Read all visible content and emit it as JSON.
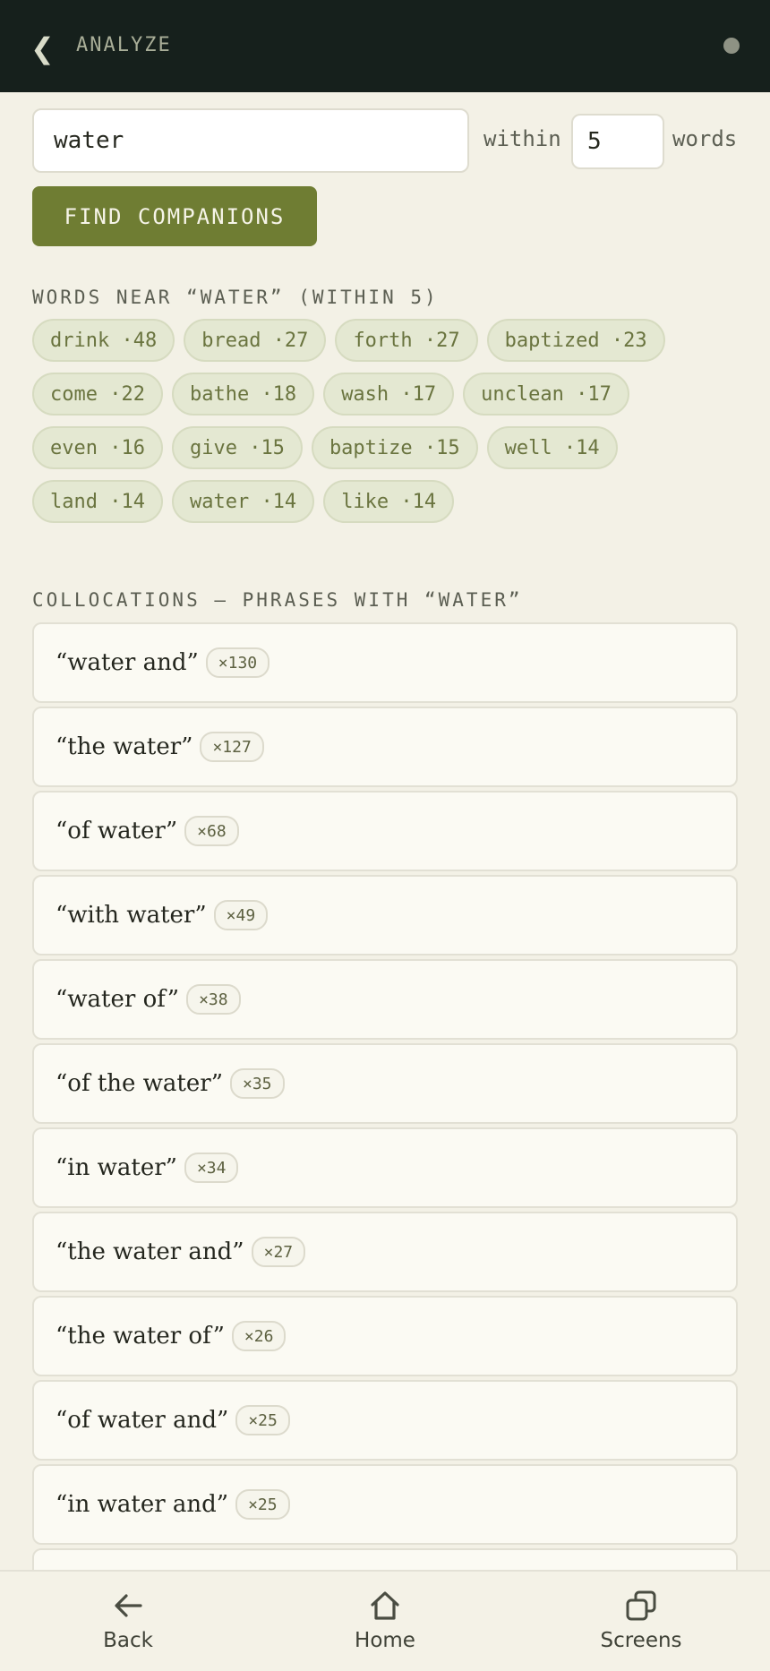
{
  "header": {
    "title": "ANALYZE"
  },
  "search": {
    "value": "water",
    "within_label": "within",
    "within_value": "5",
    "words_label": "words"
  },
  "find_button": {
    "label": "FIND COMPANIONS"
  },
  "companions": {
    "heading": "WORDS NEAR “WATER” (WITHIN 5)",
    "items": [
      "drink ·48",
      "bread ·27",
      "forth ·27",
      "baptized ·23",
      "come ·22",
      "bathe ·18",
      "wash ·17",
      "unclean ·17",
      "even ·16",
      "give ·15",
      "baptize ·15",
      "well ·14",
      "land ·14",
      "water ·14",
      "like ·14"
    ]
  },
  "collocations": {
    "heading": "COLLOCATIONS — PHRASES WITH “WATER”",
    "items": [
      {
        "phrase": "“water and”",
        "count": "×130"
      },
      {
        "phrase": "“the water”",
        "count": "×127"
      },
      {
        "phrase": "“of water”",
        "count": "×68"
      },
      {
        "phrase": "“with water”",
        "count": "×49"
      },
      {
        "phrase": "“water of”",
        "count": "×38"
      },
      {
        "phrase": "“of the water”",
        "count": "×35"
      },
      {
        "phrase": "“in water”",
        "count": "×34"
      },
      {
        "phrase": "“the water and”",
        "count": "×27"
      },
      {
        "phrase": "“the water of”",
        "count": "×26"
      },
      {
        "phrase": "“of water and”",
        "count": "×25"
      },
      {
        "phrase": "“in water and”",
        "count": "×25"
      },
      {
        "phrase": "",
        "count": ""
      }
    ]
  },
  "bottom_nav": {
    "back": "Back",
    "home": "Home",
    "screens": "Screens"
  },
  "colors": {
    "header_bg": "#16201c",
    "accent": "#6f7d33",
    "background": "#f3f1e6"
  }
}
